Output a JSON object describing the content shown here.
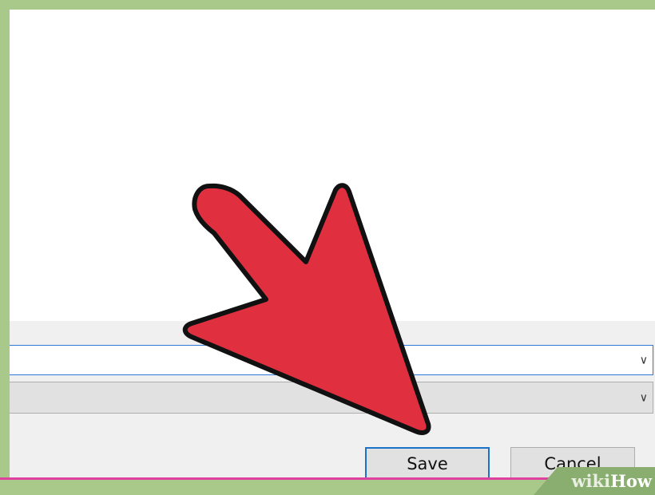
{
  "dialog": {
    "save_label": "Save",
    "cancel_label": "Cancel",
    "chevron": "∨"
  },
  "watermark": {
    "wiki": "wiki",
    "how": "How"
  },
  "colors": {
    "frame": "#a8c98a",
    "arrow_fill": "#e03040",
    "focus_border": "#2b79d8"
  },
  "icons": {
    "pointer_arrow": "red-arrow-icon",
    "dropdown": "chevron-down-icon"
  }
}
